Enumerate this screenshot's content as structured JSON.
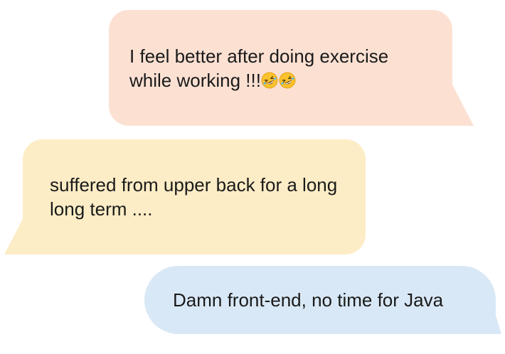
{
  "messages": [
    {
      "side": "right",
      "color": "#fce1d3",
      "text": "I feel better after doing exercise while working !!!",
      "emoji": [
        "rolling-on-floor-laughing-emoji",
        "rolling-on-floor-laughing-emoji"
      ]
    },
    {
      "side": "left",
      "color": "#fdedc6",
      "text": "suffered from upper back for a long long term ...."
    },
    {
      "side": "right",
      "color": "#d9e8f6",
      "text": "Damn front-end, no time for Java"
    }
  ]
}
